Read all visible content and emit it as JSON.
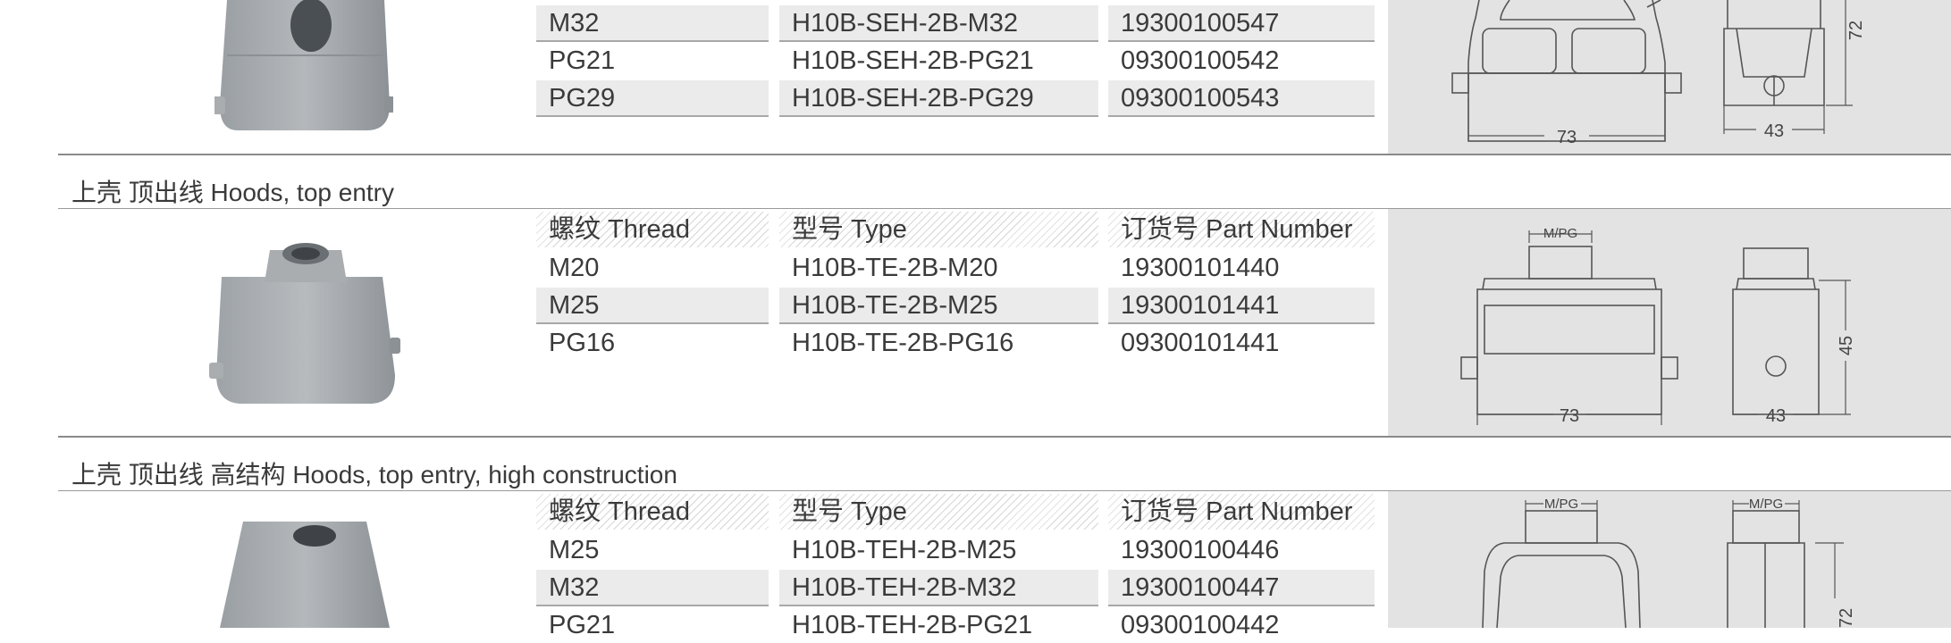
{
  "sections": [
    {
      "title": "",
      "rows": [
        {
          "thread": "M32",
          "type": "H10B-SEH-2B-M32",
          "part": "19300100547"
        },
        {
          "thread": "PG21",
          "type": "H10B-SEH-2B-PG21",
          "part": "09300100542"
        },
        {
          "thread": "PG29",
          "type": "H10B-SEH-2B-PG29",
          "part": "09300100543"
        }
      ],
      "dims": {
        "width": "73",
        "depth": "43",
        "height": "72"
      }
    },
    {
      "title": "上壳 顶出线  Hoods, top entry",
      "headers": {
        "thread": "螺纹 Thread",
        "type": "型号 Type",
        "part": "订货号 Part Number"
      },
      "rows": [
        {
          "thread": "M20",
          "type": "H10B-TE-2B-M20",
          "part": "19300101440"
        },
        {
          "thread": "M25",
          "type": "H10B-TE-2B-M25",
          "part": "19300101441"
        },
        {
          "thread": "PG16",
          "type": "H10B-TE-2B-PG16",
          "part": "09300101441"
        }
      ],
      "dims": {
        "width": "73",
        "depth": "43",
        "height": "45",
        "thread_label": "M/PG"
      }
    },
    {
      "title": "上壳 顶出线 高结构 Hoods, top entry, high construction",
      "headers": {
        "thread": "螺纹 Thread",
        "type": "型号 Type",
        "part": "订货号 Part Number"
      },
      "rows": [
        {
          "thread": "M25",
          "type": "H10B-TEH-2B-M25",
          "part": "19300100446"
        },
        {
          "thread": "M32",
          "type": "H10B-TEH-2B-M32",
          "part": "19300100447"
        },
        {
          "thread": "PG21",
          "type": "H10B-TEH-2B-PG21",
          "part": "09300100442"
        }
      ],
      "dims": {
        "height": "72",
        "thread_label": "M/PG"
      }
    }
  ]
}
